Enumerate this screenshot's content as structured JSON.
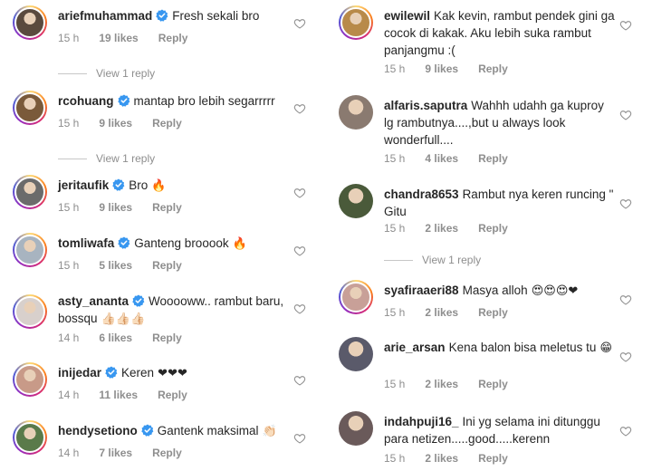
{
  "left": [
    {
      "username": "ariefmuhammad",
      "verified": true,
      "text": "Fresh sekali bro",
      "emoji": "",
      "time": "15 h",
      "likes": "19 likes",
      "reply": "Reply",
      "view_reply": "View 1 reply",
      "avatar_color": "#5a4a3e"
    },
    {
      "username": "rcohuang",
      "verified": true,
      "text": "mantap bro lebih segarrrrr",
      "emoji": "",
      "time": "15 h",
      "likes": "9 likes",
      "reply": "Reply",
      "view_reply": "View 1 reply",
      "avatar_color": "#7a5a3a"
    },
    {
      "username": "jeritaufik",
      "verified": true,
      "text": "Bro",
      "emoji": "🔥",
      "time": "15 h",
      "likes": "9 likes",
      "reply": "Reply",
      "view_reply": "",
      "avatar_color": "#6b6b6b"
    },
    {
      "username": "tomliwafa",
      "verified": true,
      "text": "Ganteng brooook",
      "emoji": "🔥",
      "time": "15 h",
      "likes": "5 likes",
      "reply": "Reply",
      "view_reply": "",
      "avatar_color": "#a8b4c0"
    },
    {
      "username": "asty_ananta",
      "verified": true,
      "text": "Wooooww.. rambut baru, bossqu",
      "emoji": "👍🏻👍🏻👍🏻",
      "time": "14 h",
      "likes": "6 likes",
      "reply": "Reply",
      "view_reply": "",
      "avatar_color": "#d8d0cc"
    },
    {
      "username": "inijedar",
      "verified": true,
      "text": "Keren",
      "emoji": "❤❤❤",
      "time": "14 h",
      "likes": "11 likes",
      "reply": "Reply",
      "view_reply": "",
      "avatar_color": "#c89a88"
    },
    {
      "username": "hendysetiono",
      "verified": true,
      "text": "Gantenk maksimal",
      "emoji": "👏🏻",
      "time": "14 h",
      "likes": "7 likes",
      "reply": "Reply",
      "view_reply": "",
      "avatar_color": "#5a7a4a"
    }
  ],
  "right": [
    {
      "username": "ewilewil",
      "verified": false,
      "text": "Kak kevin, rambut pendek gini ga cocok di kakak. Aku lebih suka rambut panjangmu :(",
      "emoji": "",
      "time": "15 h",
      "likes": "9 likes",
      "reply": "Reply",
      "view_reply": "",
      "avatar_color": "#b88a4a"
    },
    {
      "username": "alfaris.saputra",
      "verified": false,
      "text": "Wahhh udahh ga kuproy lg rambutnya....,but u always look wonderfull....",
      "emoji": "",
      "time": "15 h",
      "likes": "4 likes",
      "reply": "Reply",
      "view_reply": "",
      "avatar_color": "#8a7a70"
    },
    {
      "username": "chandra8653",
      "verified": false,
      "text": "Rambut nya keren runcing \" Gitu",
      "emoji": "",
      "time": "15 h",
      "likes": "2 likes",
      "reply": "Reply",
      "view_reply": "View 1 reply",
      "avatar_color": "#4a5a3a"
    },
    {
      "username": "syafiraaeri88",
      "verified": false,
      "text": "Masya alloh",
      "emoji": "😍😍😍❤",
      "time": "15 h",
      "likes": "2 likes",
      "reply": "Reply",
      "view_reply": "",
      "avatar_color": "#c8a098"
    },
    {
      "username": "arie_arsan",
      "verified": false,
      "text": "Kena balon bisa meletus tu",
      "emoji": "😁",
      "time": "15 h",
      "likes": "2 likes",
      "reply": "Reply",
      "view_reply": "",
      "avatar_color": "#5a5a6a"
    },
    {
      "username": "indahpuji16_",
      "verified": false,
      "text": "Ini yg selama ini ditunggu para netizen.....good.....kerenn",
      "emoji": "",
      "time": "15 h",
      "likes": "2 likes",
      "reply": "Reply",
      "view_reply": "",
      "avatar_color": "#6a5a5a"
    }
  ]
}
